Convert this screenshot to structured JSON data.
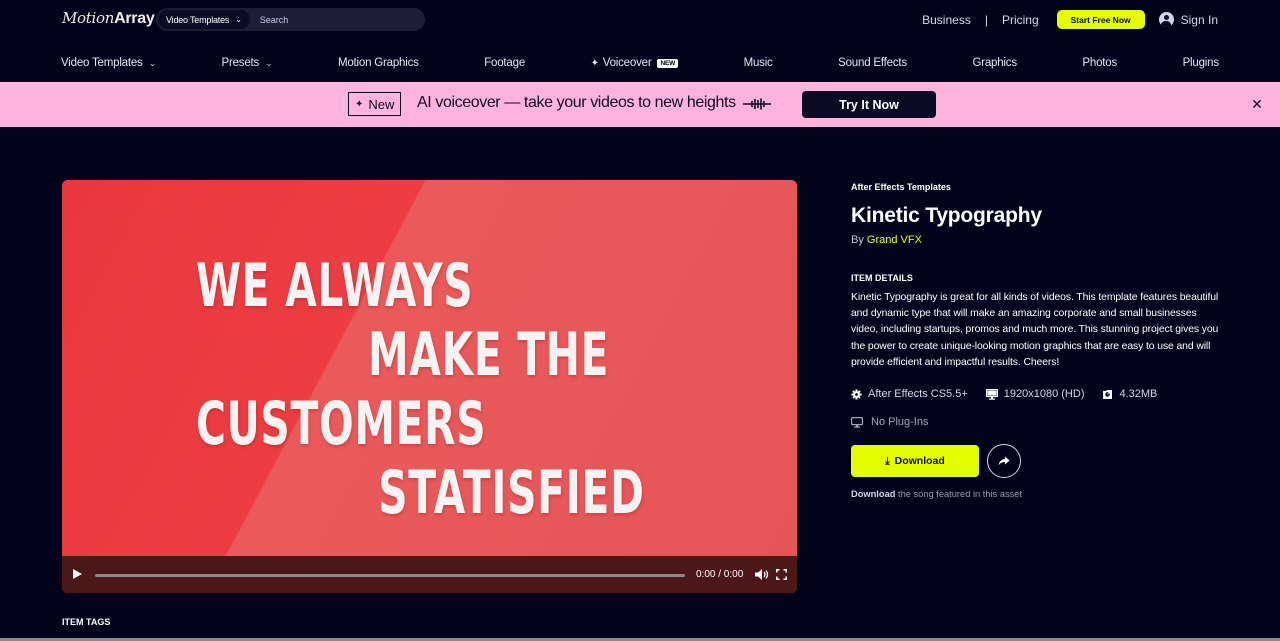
{
  "header": {
    "logo_part1": "Motion",
    "logo_part2": "Array",
    "search": {
      "category": "Video Templates",
      "placeholder": "Search"
    },
    "links": {
      "business": "Business",
      "separator": "|",
      "pricing": "Pricing"
    },
    "start_button": "Start Free Now",
    "sign_in": "Sign In"
  },
  "nav": {
    "items": [
      {
        "label": "Video Templates",
        "has_dropdown": true
      },
      {
        "label": "Presets",
        "has_dropdown": true
      },
      {
        "label": "Motion Graphics"
      },
      {
        "label": "Footage"
      },
      {
        "label": "Voiceover",
        "badge": "NEW"
      },
      {
        "label": "Music"
      },
      {
        "label": "Sound Effects"
      },
      {
        "label": "Graphics"
      },
      {
        "label": "Photos"
      },
      {
        "label": "Plugins"
      }
    ]
  },
  "promo": {
    "badge": "New",
    "text": "AI voiceover — take your videos to new heights",
    "button": "Try It Now",
    "background": "#ffb3dd"
  },
  "video": {
    "frame_lines": [
      "WE ALWAYS",
      "MAKE THE",
      "CUSTOMERS",
      "STATISFIED"
    ],
    "time": "0:00 / 0:00",
    "progress": 0
  },
  "item": {
    "category": "After Effects Templates",
    "title": "Kinetic Typography",
    "by_label": "By",
    "author": "Grand VFX",
    "details_heading": "ITEM DETAILS",
    "description": "Kinetic Typography is great for all kinds of videos. This template features beautiful and dynamic type that will make an amazing corporate and small businesses video, including startups, promos and much more. This stunning project gives you the power to create unique-looking motion graphics that are easy to use and will provide efficient and impactful results. Cheers!",
    "specs": {
      "software": "After Effects CS5.5+",
      "resolution": "1920x1080 (HD)",
      "size": "4.32MB"
    },
    "plugins": "No Plug-Ins",
    "download_button": "Download",
    "song_note_bold": "Download",
    "song_note_rest": " the song featured in this asset"
  },
  "tags_heading": "ITEM TAGS",
  "colors": {
    "background": "#03021c",
    "accent": "#e3ff00",
    "promo": "#ffb3dd"
  }
}
